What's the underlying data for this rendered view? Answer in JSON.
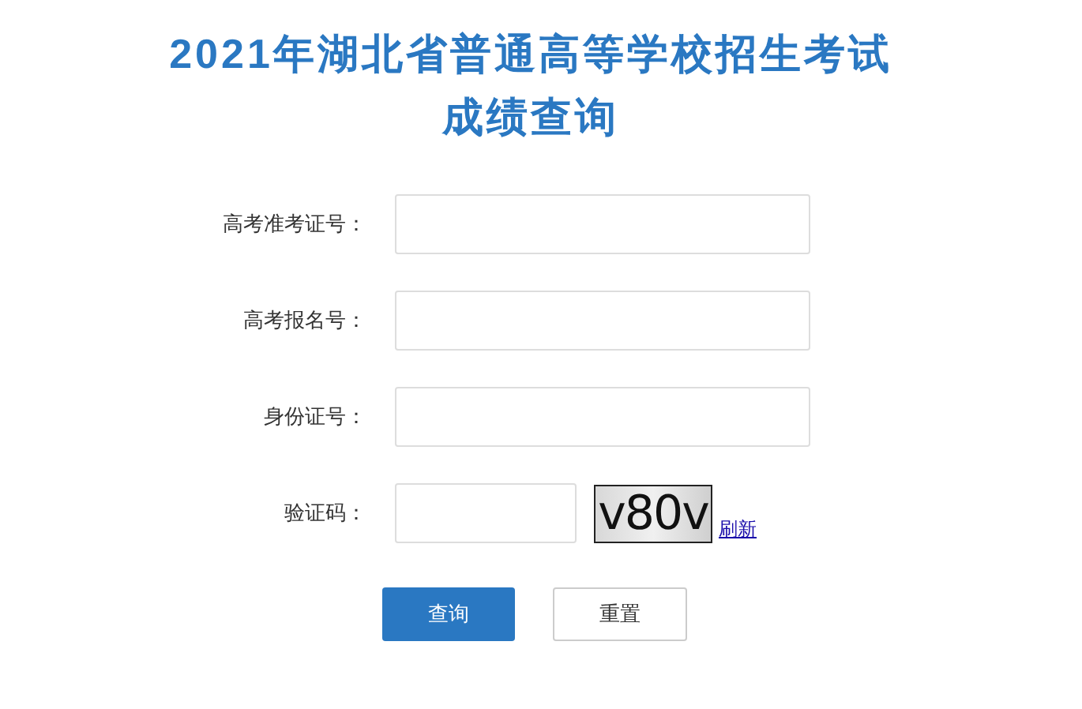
{
  "title": [
    "2021年湖北省普通高等学校招生考试",
    "成绩查询"
  ],
  "fields": [
    {
      "label": "高考准考证号：",
      "kind": "text"
    },
    {
      "label": "高考报名号：",
      "kind": "text"
    },
    {
      "label": "身份证号：",
      "kind": "text"
    },
    {
      "label": "验证码：",
      "kind": "captcha",
      "captcha": "v80v",
      "refresh": "刷新"
    }
  ],
  "buttons": [
    {
      "label": "查询",
      "kind": "primary"
    },
    {
      "label": "重置",
      "kind": "secondary"
    }
  ]
}
